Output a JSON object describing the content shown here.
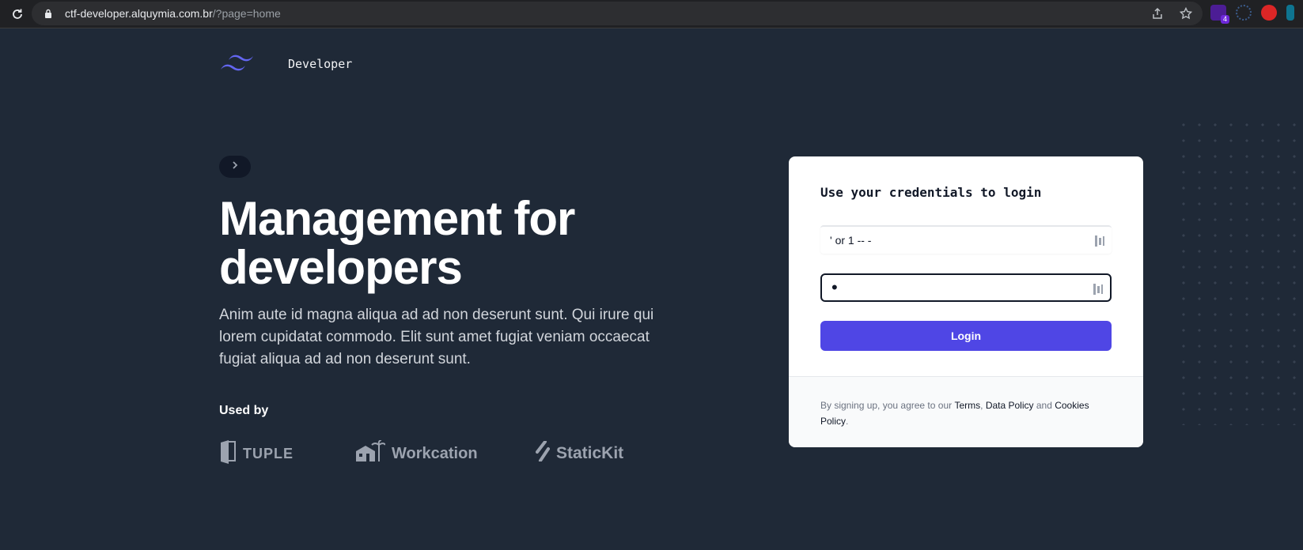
{
  "browser": {
    "url_host": "ctf-developer.alquymia.com.br",
    "url_path": "/?page=home",
    "extension_badge": "4"
  },
  "header": {
    "brand": "Developer"
  },
  "hero": {
    "headline_line1": "Management for",
    "headline_line2": "developers",
    "subcopy": "Anim aute id magna aliqua ad ad non deserunt sunt. Qui irure qui lorem cupidatat commodo. Elit sunt amet fugiat veniam occaecat fugiat aliqua ad ad non deserunt sunt.",
    "used_by_label": "Used by",
    "logos": [
      "TUPLE",
      "Workcation",
      "StaticKit"
    ]
  },
  "login": {
    "title": "Use your credentials to login",
    "username_value": "' or 1 -- -",
    "password_value": "•",
    "button_label": "Login",
    "legal": {
      "prefix": "By signing up, you agree to our ",
      "terms": "Terms",
      "comma": ",",
      "data_policy": "Data Policy",
      "and": " and ",
      "cookies_policy": "Cookies Policy",
      "suffix": "."
    }
  },
  "colors": {
    "background": "#1f2937",
    "accent": "#4f46e5",
    "logo": "#6366f1"
  }
}
